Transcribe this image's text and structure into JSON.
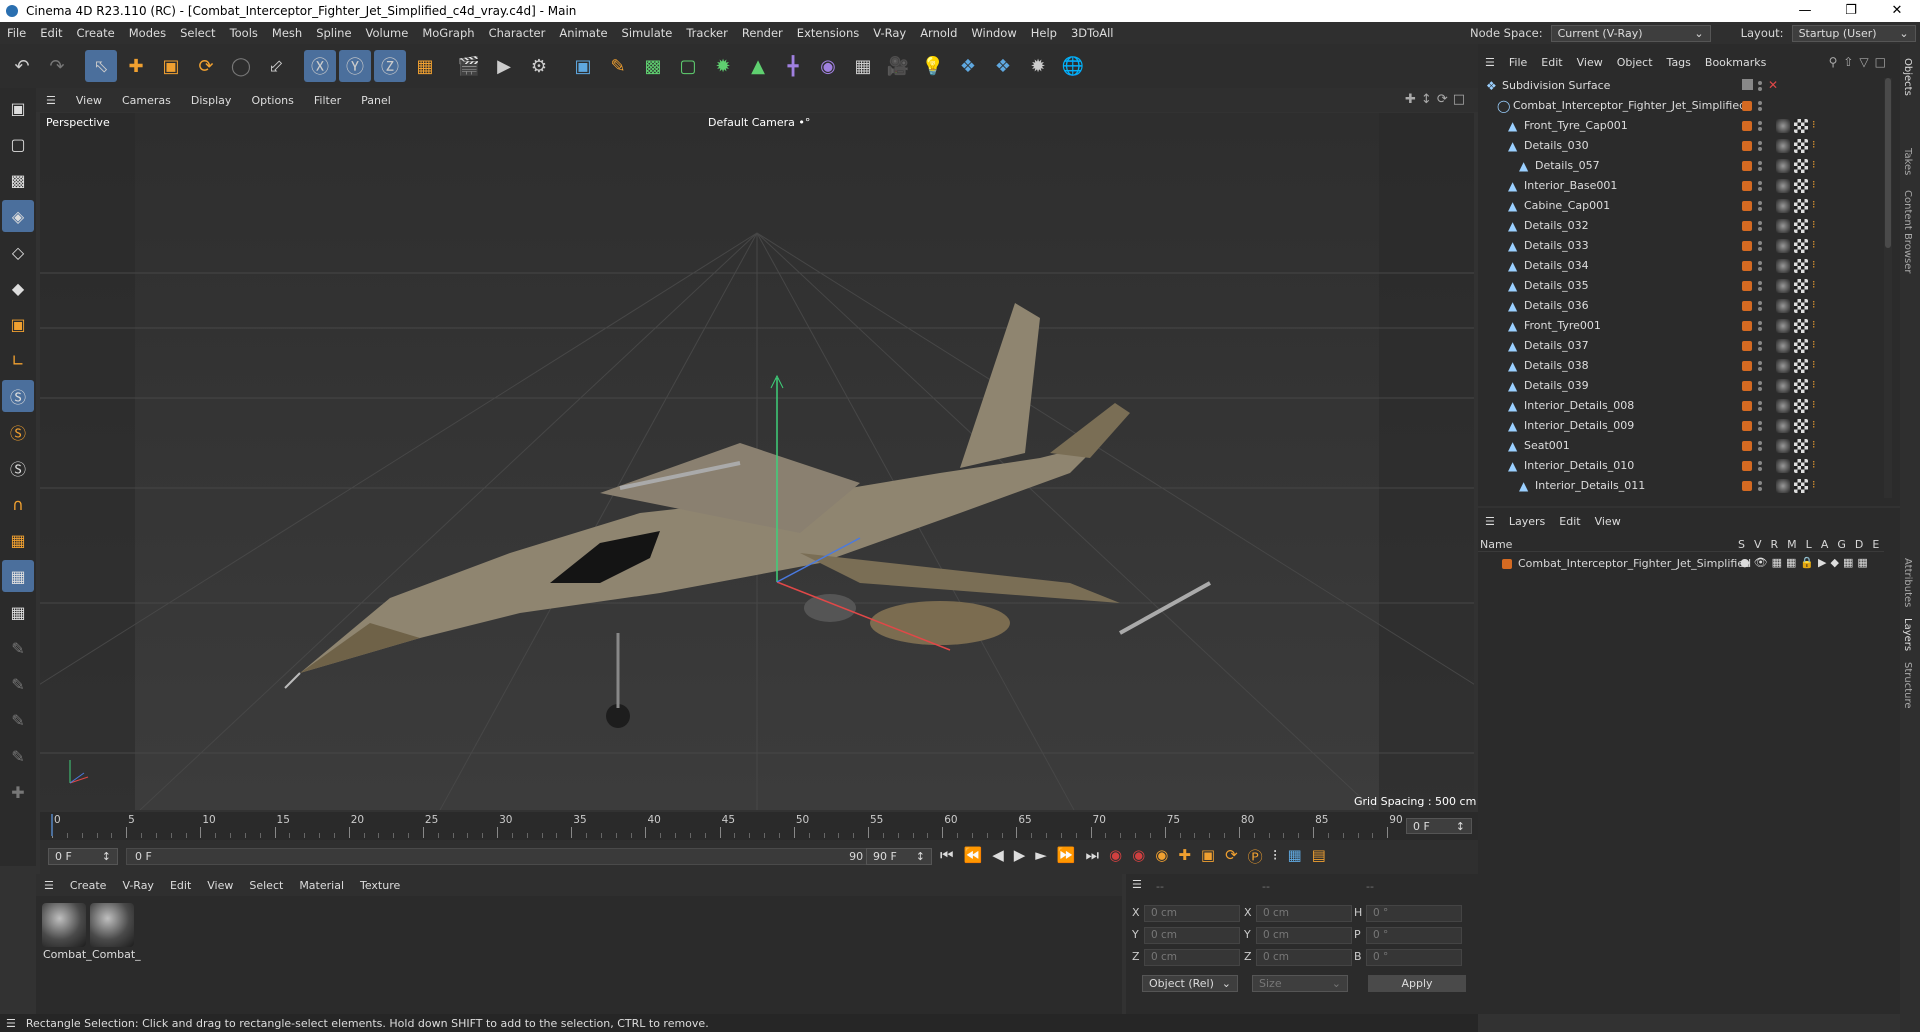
{
  "titlebar": {
    "title": "Cinema 4D R23.110 (RC) - [Combat_Interceptor_Fighter_Jet_Simplified_c4d_vray.c4d] - Main"
  },
  "menubar": {
    "items": [
      "File",
      "Edit",
      "Create",
      "Modes",
      "Select",
      "Tools",
      "Mesh",
      "Spline",
      "Volume",
      "MoGraph",
      "Character",
      "Animate",
      "Simulate",
      "Tracker",
      "Render",
      "Extensions",
      "V-Ray",
      "Arnold",
      "Window",
      "Help",
      "3DToAll"
    ],
    "node_space_label": "Node Space:",
    "node_space_value": "Current (V-Ray)",
    "layout_label": "Layout:",
    "layout_value": "Startup (User)"
  },
  "viewport": {
    "menu": [
      "View",
      "Cameras",
      "Display",
      "Options",
      "Filter",
      "Panel"
    ],
    "label": "Perspective",
    "camera": "Default Camera",
    "camera_icon": "•°",
    "grid_spacing": "Grid Spacing : 500 cm"
  },
  "timeline": {
    "ticks": [
      "0",
      "5",
      "10",
      "15",
      "20",
      "25",
      "30",
      "35",
      "40",
      "45",
      "50",
      "55",
      "60",
      "65",
      "70",
      "75",
      "80",
      "85",
      "90"
    ],
    "current_frame": "0 F",
    "start_field": "0 F",
    "range_start": "0 F",
    "range_end": "90 F",
    "end_field": "90 F"
  },
  "materials": {
    "menu": [
      "Create",
      "V-Ray",
      "Edit",
      "View",
      "Select",
      "Material",
      "Texture"
    ],
    "items": [
      "Combat_",
      "Combat_"
    ]
  },
  "coords": {
    "header": [
      "--",
      "--",
      "--"
    ],
    "rows": [
      {
        "l1": "X",
        "v1": "0 cm",
        "l2": "X",
        "v2": "0 cm",
        "l3": "H",
        "v3": "0 °"
      },
      {
        "l1": "Y",
        "v1": "0 cm",
        "l2": "Y",
        "v2": "0 cm",
        "l3": "P",
        "v3": "0 °"
      },
      {
        "l1": "Z",
        "v1": "0 cm",
        "l2": "Z",
        "v2": "0 cm",
        "l3": "B",
        "v3": "0 °"
      }
    ],
    "mode": "Object (Rel)",
    "size": "Size",
    "apply": "Apply"
  },
  "status": {
    "text": "Rectangle Selection: Click and drag to rectangle-select elements. Hold down SHIFT to add to the selection, CTRL to remove."
  },
  "objects": {
    "menu": [
      "File",
      "Edit",
      "View",
      "Object",
      "Tags",
      "Bookmarks"
    ],
    "rows": [
      {
        "name": "Subdivision Surface",
        "depth": 0
      },
      {
        "name": "Combat_Interceptor_Fighter_Jet_Simplified",
        "depth": 1
      },
      {
        "name": "Front_Tyre_Cap001",
        "depth": 2
      },
      {
        "name": "Details_030",
        "depth": 2
      },
      {
        "name": "Details_057",
        "depth": 3
      },
      {
        "name": "Interior_Base001",
        "depth": 2
      },
      {
        "name": "Cabine_Cap001",
        "depth": 2
      },
      {
        "name": "Details_032",
        "depth": 2
      },
      {
        "name": "Details_033",
        "depth": 2
      },
      {
        "name": "Details_034",
        "depth": 2
      },
      {
        "name": "Details_035",
        "depth": 2
      },
      {
        "name": "Details_036",
        "depth": 2
      },
      {
        "name": "Front_Tyre001",
        "depth": 2
      },
      {
        "name": "Details_037",
        "depth": 2
      },
      {
        "name": "Details_038",
        "depth": 2
      },
      {
        "name": "Details_039",
        "depth": 2
      },
      {
        "name": "Interior_Details_008",
        "depth": 2
      },
      {
        "name": "Interior_Details_009",
        "depth": 2
      },
      {
        "name": "Seat001",
        "depth": 2
      },
      {
        "name": "Interior_Details_010",
        "depth": 2
      },
      {
        "name": "Interior_Details_011",
        "depth": 3
      }
    ]
  },
  "layers": {
    "menu": [
      "Layers",
      "Edit",
      "View"
    ],
    "columns": {
      "name": "Name",
      "flags": [
        "S",
        "V",
        "R",
        "M",
        "L",
        "A",
        "G",
        "D",
        "E"
      ]
    },
    "rows": [
      {
        "name": "Combat_Interceptor_Fighter_Jet_Simplified"
      }
    ]
  },
  "sidetabs": [
    "Objects",
    "Takes",
    "Content Browser",
    "Attributes",
    "Layers",
    "Structure"
  ],
  "colors": {
    "accent": "#4b6f9c",
    "tag_orange": "#d46a22",
    "bg": "#323232"
  }
}
